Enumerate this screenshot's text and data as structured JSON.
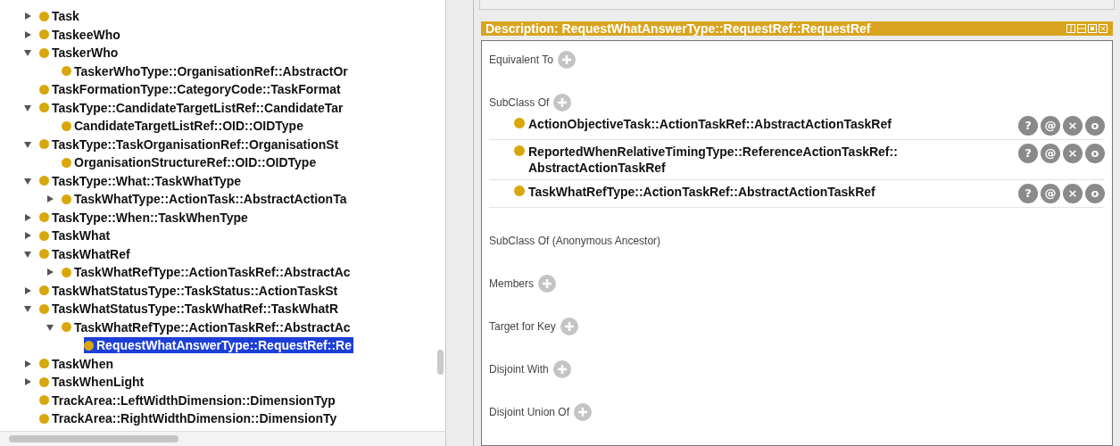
{
  "tree": {
    "items": [
      {
        "label": "Task",
        "expanded": false,
        "selected": false
      },
      {
        "label": "TaskeeWho",
        "expanded": false,
        "selected": false
      },
      {
        "label": "TaskerWho",
        "expanded": true,
        "selected": false,
        "children": [
          {
            "label": "TaskerWhoType::OrganisationRef::AbstractOr",
            "selected": false
          }
        ]
      },
      {
        "label": "TaskFormationType::CategoryCode::TaskFormat",
        "selected": false
      },
      {
        "label": "TaskType::CandidateTargetListRef::CandidateTar",
        "expanded": true,
        "selected": false,
        "children": [
          {
            "label": "CandidateTargetListRef::OID::OIDType",
            "selected": false
          }
        ]
      },
      {
        "label": "TaskType::TaskOrganisationRef::OrganisationSt",
        "expanded": true,
        "selected": false,
        "children": [
          {
            "label": "OrganisationStructureRef::OID::OIDType",
            "selected": false
          }
        ]
      },
      {
        "label": "TaskType::What::TaskWhatType",
        "expanded": true,
        "selected": false,
        "children": [
          {
            "label": "TaskWhatType::ActionTask::AbstractActionTa",
            "expanded": false,
            "selected": false
          }
        ]
      },
      {
        "label": "TaskType::When::TaskWhenType",
        "expanded": false,
        "selected": false
      },
      {
        "label": "TaskWhat",
        "expanded": false,
        "selected": false
      },
      {
        "label": "TaskWhatRef",
        "expanded": true,
        "selected": false,
        "children": [
          {
            "label": "TaskWhatRefType::ActionTaskRef::AbstractAc",
            "expanded": false,
            "selected": false
          }
        ]
      },
      {
        "label": "TaskWhatStatusType::TaskStatus::ActionTaskSt",
        "expanded": false,
        "selected": false
      },
      {
        "label": "TaskWhatStatusType::TaskWhatRef::TaskWhatR",
        "expanded": true,
        "selected": false,
        "children": [
          {
            "label": "TaskWhatRefType::ActionTaskRef::AbstractAc",
            "expanded": true,
            "selected": false,
            "children": [
              {
                "label": "RequestWhatAnswerType::RequestRef::Re",
                "selected": true
              }
            ]
          }
        ]
      },
      {
        "label": "TaskWhen",
        "expanded": false,
        "selected": false
      },
      {
        "label": "TaskWhenLight",
        "expanded": false,
        "selected": false
      },
      {
        "label": "TrackArea::LeftWidthDimension::DimensionTyp",
        "selected": false
      },
      {
        "label": "TrackArea::RightWidthDimension::DimensionTy",
        "selected": false
      }
    ]
  },
  "description": {
    "title": "Description: RequestWhatAnswerType::RequestRef::RequestRef",
    "sections": [
      {
        "label": "Equivalent To",
        "addable": true
      },
      {
        "label": "SubClass Of",
        "addable": true,
        "items": [
          {
            "text": "ActionObjectiveTask::ActionTaskRef::AbstractActionTaskRef",
            "actions": [
              "?",
              "@",
              "×",
              "o"
            ]
          },
          {
            "text": "ReportedWhenRelativeTimingType::ReferenceActionTaskRef::AbstractActionTaskRef",
            "actions": [
              "?",
              "@",
              "×",
              "o"
            ]
          },
          {
            "text": "TaskWhatRefType::ActionTaskRef::AbstractActionTaskRef",
            "actions": [
              "?",
              "@",
              "×",
              "o"
            ]
          }
        ]
      },
      {
        "label": "SubClass Of (Anonymous Ancestor)",
        "addable": false
      },
      {
        "label": "Members",
        "addable": true
      },
      {
        "label": "Target for Key",
        "addable": true
      },
      {
        "label": "Disjoint With",
        "addable": true
      },
      {
        "label": "Disjoint Union Of",
        "addable": true
      }
    ]
  }
}
